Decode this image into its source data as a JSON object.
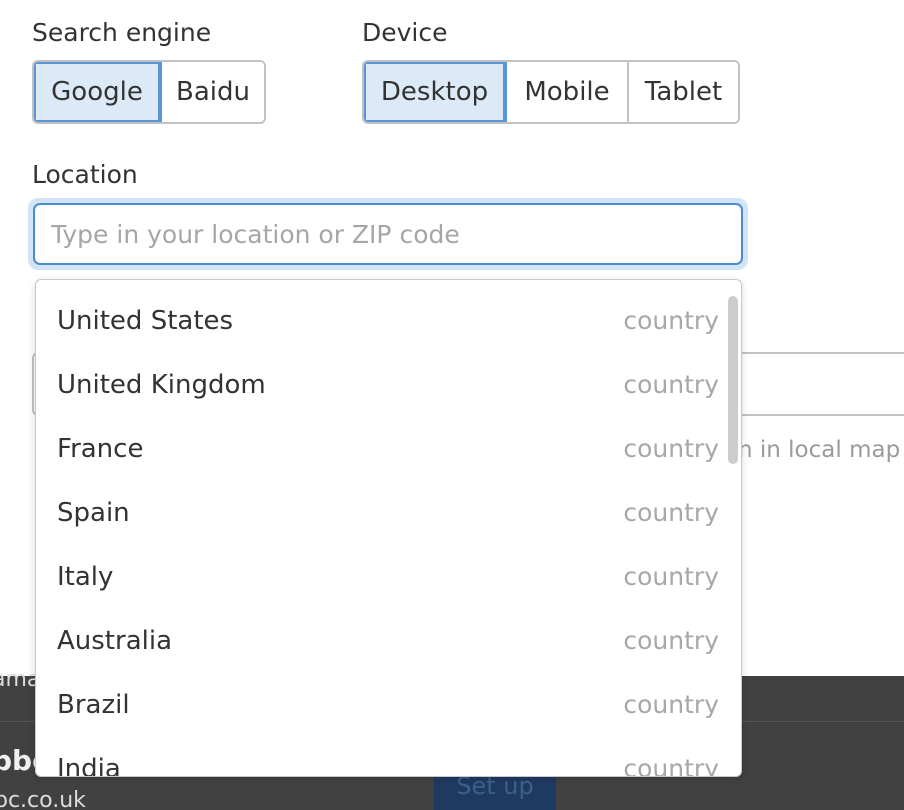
{
  "search_engine": {
    "label": "Search engine",
    "options": [
      "Google",
      "Baidu"
    ],
    "selected": "Google"
  },
  "device": {
    "label": "Device",
    "options": [
      "Desktop",
      "Mobile",
      "Tablet"
    ],
    "selected": "Desktop"
  },
  "location": {
    "label": "Location",
    "value": "",
    "placeholder": "Type in your location or ZIP code"
  },
  "dropdown": {
    "items": [
      {
        "name": "United States",
        "type": "country"
      },
      {
        "name": "United Kingdom",
        "type": "country"
      },
      {
        "name": "France",
        "type": "country"
      },
      {
        "name": "Spain",
        "type": "country"
      },
      {
        "name": "Italy",
        "type": "country"
      },
      {
        "name": "Australia",
        "type": "country"
      },
      {
        "name": "Brazil",
        "type": "country"
      },
      {
        "name": "India",
        "type": "country"
      }
    ]
  },
  "background": {
    "hint_fragment": "n in local map p",
    "row_text_fragment": "ama",
    "site_name_fragment": "bbc",
    "site_url_fragment": "bc.co.uk",
    "setup_button": "Set up"
  },
  "colors": {
    "selected_bg": "#dce9f7",
    "selected_border": "#5a95d6",
    "focus_border": "#4a8bd1",
    "dark_band": "#414141",
    "setup_button": "#1f3a60"
  }
}
